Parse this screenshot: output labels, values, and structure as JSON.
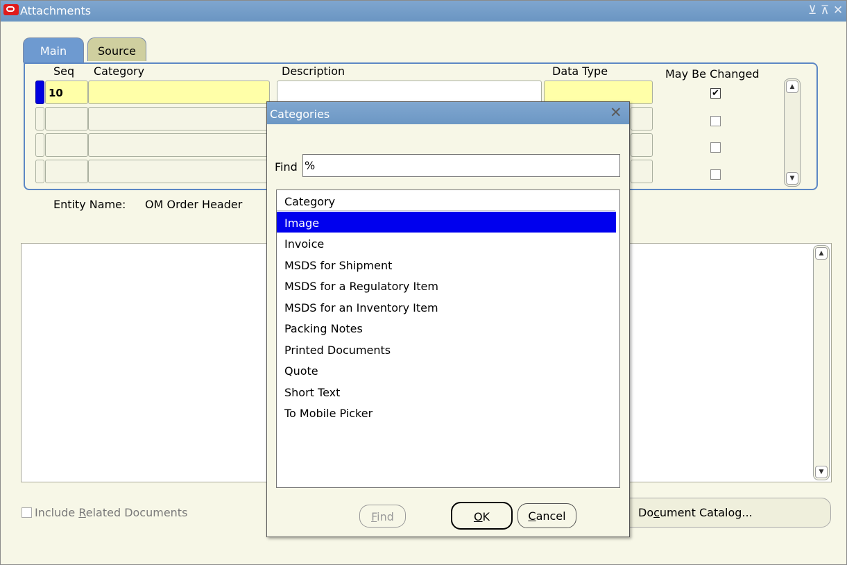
{
  "window": {
    "title": "Attachments",
    "controls": [
      "⊻",
      "⊼",
      "✕"
    ]
  },
  "tabs": [
    {
      "label": "Main",
      "active": true
    },
    {
      "label": "Source",
      "active": false
    }
  ],
  "table": {
    "headers": {
      "seq": "Seq",
      "category": "Category",
      "description": "Description",
      "data_type": "Data Type",
      "may_be_changed": "May Be Changed"
    },
    "rows": [
      {
        "seq": "10",
        "category": "",
        "description": "",
        "data_type": "",
        "may_be_changed": true
      },
      {
        "seq": "",
        "category": "",
        "description": "",
        "data_type": "",
        "may_be_changed": false
      },
      {
        "seq": "",
        "category": "",
        "description": "",
        "data_type": "",
        "may_be_changed": false
      },
      {
        "seq": "",
        "category": "",
        "description": "",
        "data_type": "",
        "may_be_changed": false
      }
    ]
  },
  "entity": {
    "label": "Entity Name:",
    "value": "OM Order Header"
  },
  "footer": {
    "include_related_pre": "Include ",
    "include_related_ul": "R",
    "include_related_post": "elated Documents",
    "document_catalog_pre": "Do",
    "document_catalog_ul": "c",
    "document_catalog_post": "ument Catalog..."
  },
  "dialog": {
    "title": "Categories",
    "find_label": "Find",
    "find_value": "%",
    "list_header": "Category",
    "items": [
      "Image",
      "Invoice",
      "MSDS for Shipment",
      "MSDS for a Regulatory Item",
      "MSDS for an Inventory Item",
      "Packing Notes",
      "Printed Documents",
      "Quote",
      "Short Text",
      "To Mobile Picker"
    ],
    "selected_index": 0,
    "buttons": {
      "find_ul": "F",
      "find_rest": "ind",
      "ok_ul": "O",
      "ok_rest": "K",
      "cancel_ul": "C",
      "cancel_rest": "ancel"
    }
  },
  "colors": {
    "titlebar": "#6e9ad0",
    "selection": "#0000ee",
    "required_field": "#ffffa8"
  }
}
